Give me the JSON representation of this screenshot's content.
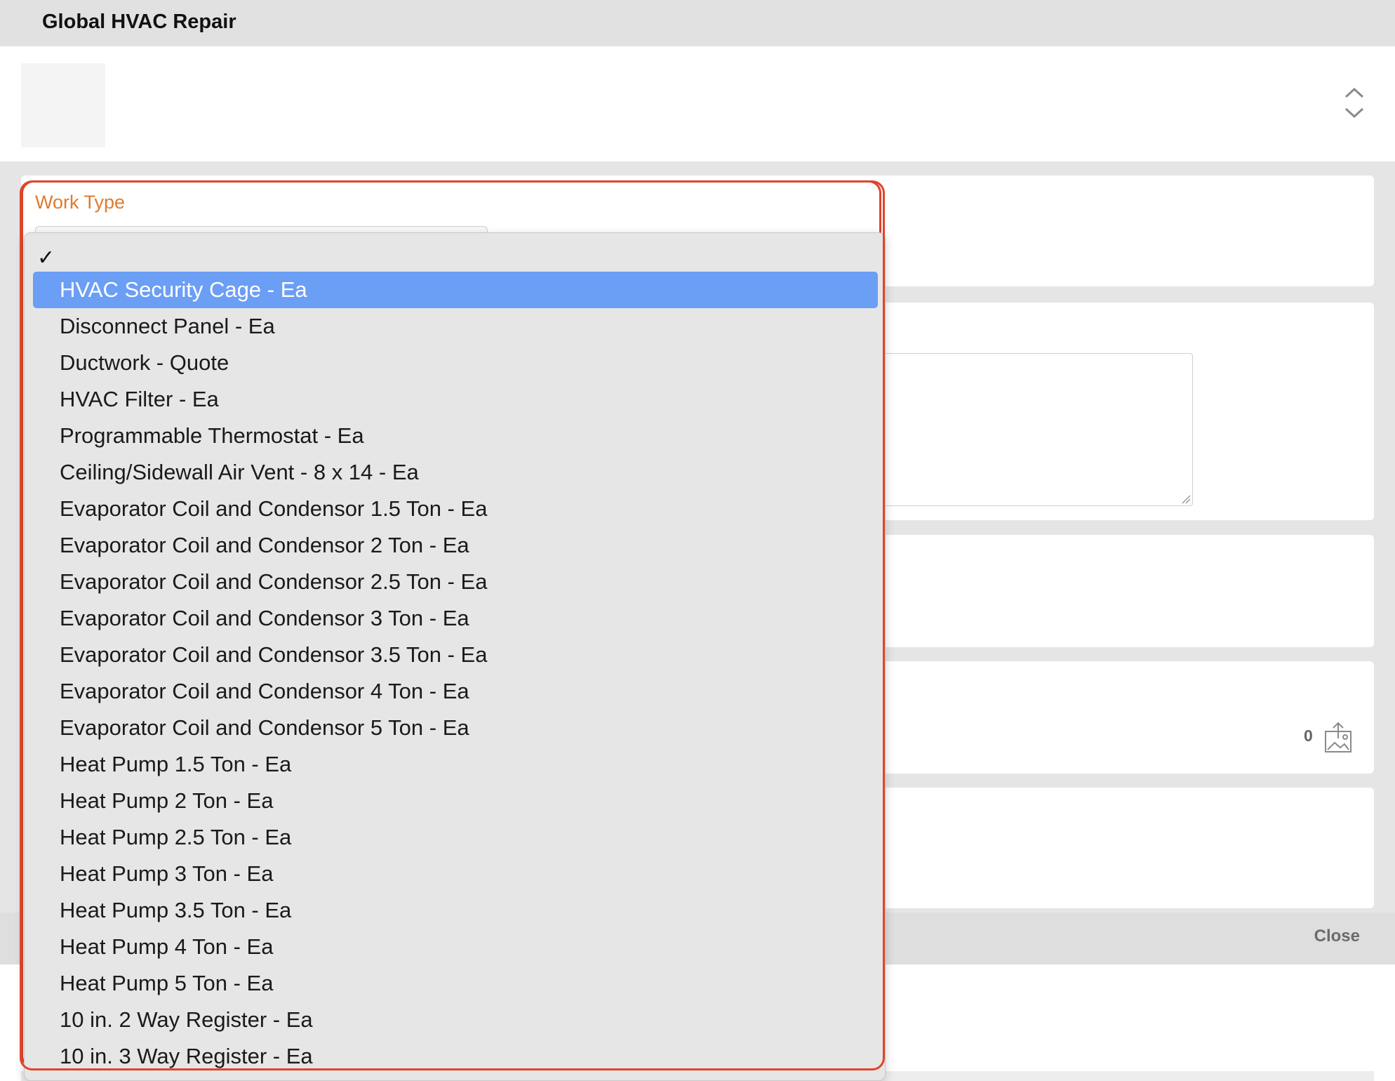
{
  "window": {
    "title": "Global HVAC Repair"
  },
  "work_type": {
    "label": "Work Type",
    "checkmark": "✓",
    "options": [
      "HVAC Security Cage - Ea",
      "Disconnect Panel - Ea",
      "Ductwork - Quote",
      "HVAC Filter - Ea",
      "Programmable Thermostat - Ea",
      "Ceiling/Sidewall Air Vent - 8 x 14 - Ea",
      "Evaporator Coil and Condensor 1.5 Ton - Ea",
      "Evaporator Coil and Condensor 2 Ton - Ea",
      "Evaporator Coil and Condensor 2.5 Ton - Ea",
      "Evaporator Coil and Condensor 3 Ton - Ea",
      "Evaporator Coil and Condensor 3.5 Ton - Ea",
      "Evaporator Coil and Condensor 4 Ton - Ea",
      "Evaporator Coil and Condensor 5 Ton - Ea",
      "Heat Pump 1.5 Ton - Ea",
      "Heat Pump 2 Ton - Ea",
      "Heat Pump 2.5 Ton - Ea",
      "Heat Pump 3 Ton - Ea",
      "Heat Pump 3.5 Ton - Ea",
      "Heat Pump 4 Ton - Ea",
      "Heat Pump 5 Ton - Ea",
      "10 in. 2 Way Register - Ea",
      "10 in. 3 Way Register - Ea"
    ],
    "highlighted_option": "HVAC Security Cage - Ea"
  },
  "attachments": {
    "count": "0"
  },
  "footer": {
    "close_label": "Close"
  },
  "colors": {
    "highlight": "#6b9ef5",
    "label_orange": "#e07a2d",
    "frame_red": "#e0442a"
  }
}
